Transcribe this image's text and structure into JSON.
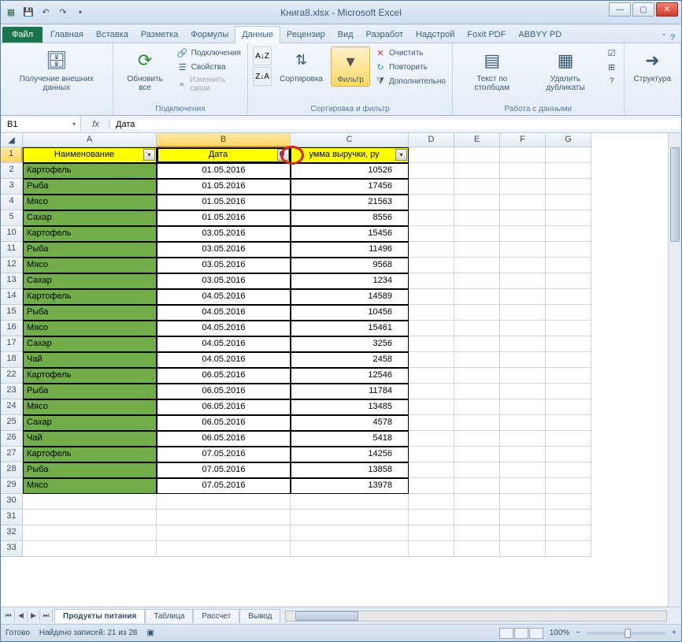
{
  "window": {
    "title": "Книга8.xlsx - Microsoft Excel"
  },
  "ribbon_tabs": {
    "file": "Файл",
    "tabs": [
      "Главная",
      "Вставка",
      "Разметка",
      "Формулы",
      "Данные",
      "Рецензир",
      "Вид",
      "Разработ",
      "Надстрой",
      "Foxit PDF",
      "ABBYY PD"
    ],
    "active_index": 4
  },
  "ribbon": {
    "external_data": {
      "label": "Получение внешних данных",
      "btn": "Получение внешних данных"
    },
    "connections": {
      "label": "Подключения",
      "refresh": "Обновить все",
      "items": [
        "Подключения",
        "Свойства",
        "Изменить связи"
      ]
    },
    "sort_filter": {
      "label": "Сортировка и фильтр",
      "sort": "Сортировка",
      "filter": "Фильтр",
      "items": [
        "Очистить",
        "Повторить",
        "Дополнительно"
      ]
    },
    "data_tools": {
      "label": "Работа с данными",
      "text_cols": "Текст по столбцам",
      "dedup": "Удалить дубликаты"
    },
    "outline": {
      "label": "",
      "btn": "Структура"
    }
  },
  "name_box": "B1",
  "formula": "Дата",
  "columns": [
    "A",
    "B",
    "C",
    "D",
    "E",
    "F",
    "G"
  ],
  "headers": {
    "a": "Наименование",
    "b": "Дата",
    "c": "умма выручки, ру"
  },
  "rows": [
    {
      "n": 2,
      "name": "Картофель",
      "date": "01.05.2016",
      "val": "10526"
    },
    {
      "n": 3,
      "name": "Рыба",
      "date": "01.05.2016",
      "val": "17456"
    },
    {
      "n": 4,
      "name": "Мясо",
      "date": "01.05.2016",
      "val": "21563"
    },
    {
      "n": 5,
      "name": "Сахар",
      "date": "01.05.2016",
      "val": "8556"
    },
    {
      "n": 10,
      "name": "Картофель",
      "date": "03.05.2016",
      "val": "15456"
    },
    {
      "n": 11,
      "name": "Рыба",
      "date": "03.05.2016",
      "val": "11496"
    },
    {
      "n": 12,
      "name": "Мясо",
      "date": "03.05.2016",
      "val": "9568"
    },
    {
      "n": 13,
      "name": "Сахар",
      "date": "03.05.2016",
      "val": "1234"
    },
    {
      "n": 14,
      "name": "Картофель",
      "date": "04.05.2016",
      "val": "14589"
    },
    {
      "n": 15,
      "name": "Рыба",
      "date": "04.05.2016",
      "val": "10456"
    },
    {
      "n": 16,
      "name": "Мясо",
      "date": "04.05.2016",
      "val": "15461"
    },
    {
      "n": 17,
      "name": "Сахар",
      "date": "04.05.2016",
      "val": "3256"
    },
    {
      "n": 18,
      "name": "Чай",
      "date": "04.05.2016",
      "val": "2458"
    },
    {
      "n": 22,
      "name": "Картофель",
      "date": "06.05.2016",
      "val": "12546"
    },
    {
      "n": 23,
      "name": "Рыба",
      "date": "06.05.2016",
      "val": "11784"
    },
    {
      "n": 24,
      "name": "Мясо",
      "date": "06.05.2016",
      "val": "13485"
    },
    {
      "n": 25,
      "name": "Сахар",
      "date": "06.05.2016",
      "val": "4578"
    },
    {
      "n": 26,
      "name": "Чай",
      "date": "06.05.2016",
      "val": "5418"
    },
    {
      "n": 27,
      "name": "Картофель",
      "date": "07.05.2016",
      "val": "14256"
    },
    {
      "n": 28,
      "name": "Рыба",
      "date": "07.05.2016",
      "val": "13858"
    },
    {
      "n": 29,
      "name": "Мясо",
      "date": "07.05.2016",
      "val": "13978"
    }
  ],
  "blank_rows": [
    30,
    31,
    32,
    33
  ],
  "sheet_tabs": [
    "Продукты питания",
    "Таблица",
    "Рассчет",
    "Вывод"
  ],
  "active_sheet": 0,
  "status": {
    "ready": "Готово",
    "found": "Найдено записей: 21 из 28",
    "zoom": "100%"
  }
}
